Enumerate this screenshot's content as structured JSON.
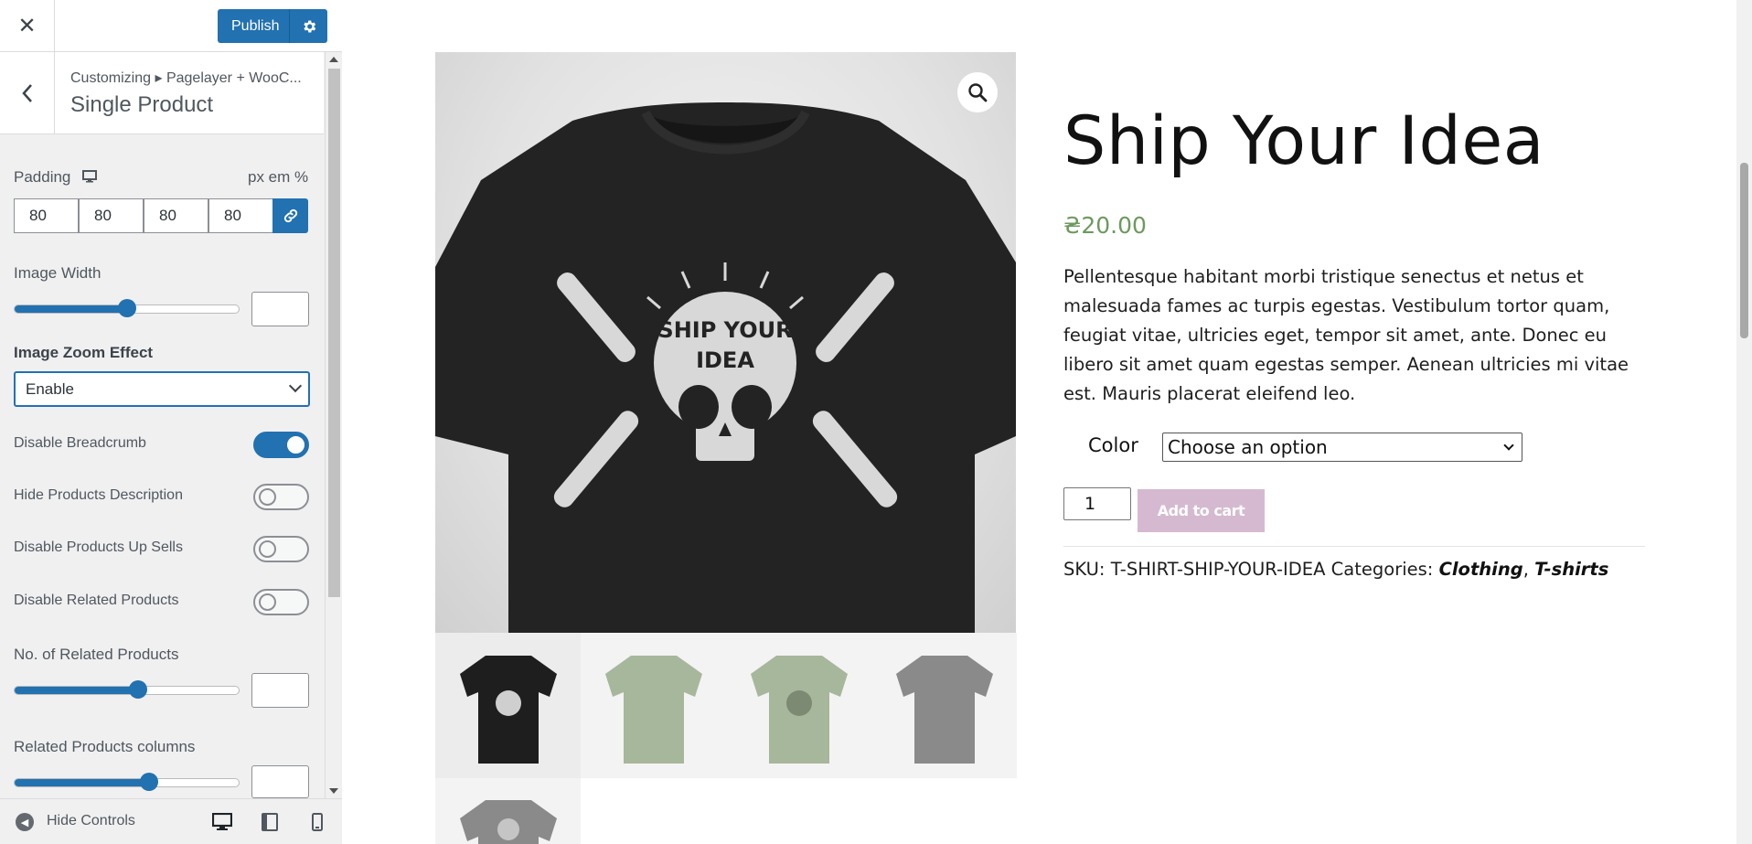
{
  "customizer": {
    "close_glyph": "✕",
    "publish_label": "Publish",
    "breadcrumb": "Customizing ▸ Pagelayer + WooC...",
    "section_title": "Single Product",
    "padding": {
      "label": "Padding",
      "units": "px em %",
      "values": [
        "80",
        "80",
        "80",
        "80"
      ]
    },
    "image_width": {
      "label": "Image Width",
      "value_fraction": 0.5,
      "box_value": ""
    },
    "zoom_effect": {
      "label": "Image Zoom Effect",
      "selected": "Enable"
    },
    "toggles": [
      {
        "label": "Disable Breadcrumb",
        "on": true
      },
      {
        "label": "Hide Products Description",
        "on": false
      },
      {
        "label": "Disable Products Up Sells",
        "on": false
      },
      {
        "label": "Disable Related Products",
        "on": false
      }
    ],
    "related_count": {
      "label": "No. of Related Products",
      "value_fraction": 0.55,
      "box_value": ""
    },
    "related_columns": {
      "label": "Related Products columns",
      "value_fraction": 0.6,
      "box_value": ""
    },
    "hide_controls_label": "Hide Controls"
  },
  "product": {
    "title": "Ship Your Idea",
    "price": "₴20.00",
    "description": "Pellentesque habitant morbi tristique senectus et netus et malesuada fames ac turpis egestas. Vestibulum tortor quam, feugiat vitae, ultricies eget, tempor sit amet, ante. Donec eu libero sit amet quam egestas semper. Aenean ultricies mi vitae est. Mauris placerat eleifend leo.",
    "color_label": "Color",
    "color_select": "Choose an option",
    "quantity": "1",
    "add_to_cart": "Add to cart",
    "sku_label": "SKU:",
    "sku": "T-SHIRT-SHIP-YOUR-IDEA",
    "categories_label": "Categories:",
    "categories": [
      "Clothing",
      "T-shirts"
    ],
    "category_separator": ",",
    "shirt_print": {
      "line1": "SHIP YOUR",
      "line2": "IDEA"
    },
    "thumbnails": [
      {
        "color": "#1e1e1e",
        "variant": "black-skull"
      },
      {
        "color": "#a7b79b",
        "variant": "green-plain"
      },
      {
        "color": "#a7b79b",
        "variant": "green-skull"
      },
      {
        "color": "#8a8a8a",
        "variant": "grey-back"
      },
      {
        "color": "#8a8a8a",
        "variant": "grey-skull"
      }
    ]
  },
  "colors": {
    "accent": "#2271b1",
    "price_green": "#6c9a5d",
    "add_to_cart_disabled": "#d5b9d1"
  }
}
